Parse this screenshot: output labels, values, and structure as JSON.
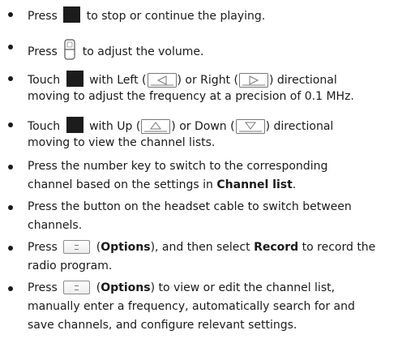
{
  "items": [
    {
      "lines": [
        [
          "Press ",
          "[play]",
          " to stop or continue the playing."
        ]
      ]
    },
    {
      "lines": [
        [
          "Press ",
          "[vol]",
          " to adjust the volume."
        ]
      ]
    },
    {
      "lines": [
        [
          "Touch ",
          "[play]",
          " with Left (",
          "[left]",
          ") or Right (",
          "[right]",
          ") directional"
        ],
        [
          "moving to adjust the frequency at a precision of 0.1 MHz."
        ]
      ]
    },
    {
      "lines": [
        [
          "Touch ",
          "[play]",
          " with Up (",
          "[up]",
          ") or Down (",
          "[down]",
          ") directional"
        ],
        [
          "moving to view the channel lists."
        ]
      ]
    },
    {
      "lines": [
        [
          "Press the number key to switch to the corresponding"
        ],
        [
          "channel based on the settings in ",
          "**Channel list",
          "."
        ]
      ]
    },
    {
      "lines": [
        [
          "Press the button on the headset cable to switch between"
        ],
        [
          "channels."
        ]
      ]
    },
    {
      "lines": [
        [
          "Press ",
          "[opt]",
          " (",
          "**Options",
          "), and then select ",
          "**Record",
          " to record the"
        ],
        [
          "radio program."
        ]
      ]
    },
    {
      "lines": [
        [
          "Press ",
          "[opt]",
          " (",
          "**Options",
          ") to view or edit the channel list,"
        ],
        [
          "manually enter a frequency, automatically search for and"
        ],
        [
          "save channels, and configure relevant settings."
        ]
      ]
    }
  ],
  "icons": {
    "play": "play-pause-key-icon",
    "vol": "volume-key-icon",
    "left": "left-arrow-key-icon",
    "right": "right-arrow-key-icon",
    "up": "up-arrow-key-icon",
    "down": "down-arrow-key-icon",
    "opt": "options-key-icon"
  }
}
